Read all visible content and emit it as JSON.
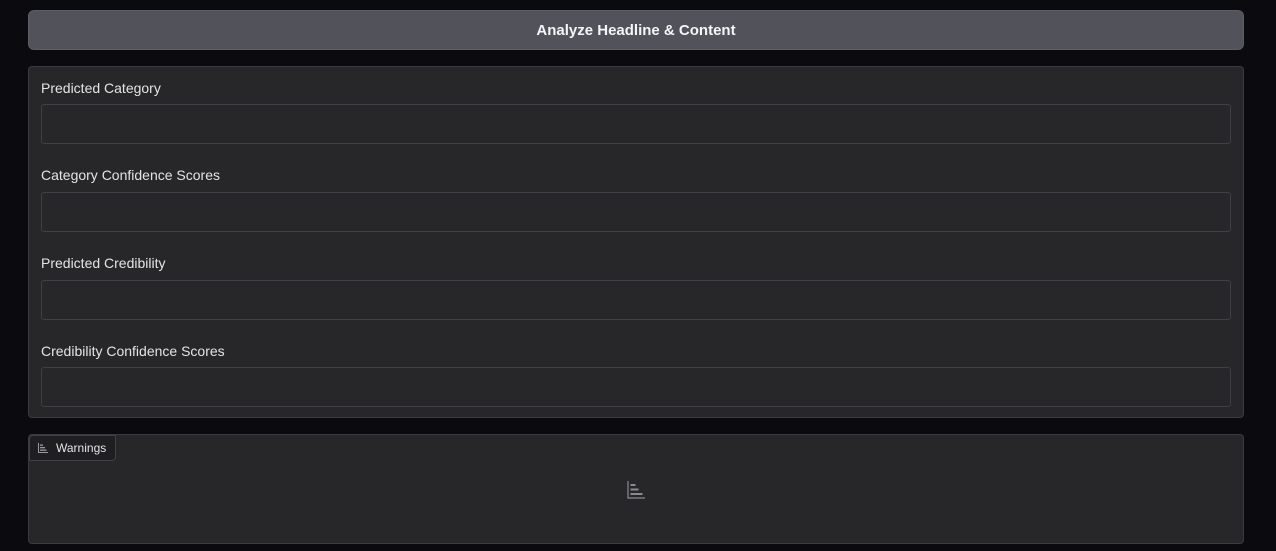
{
  "analyze_button": {
    "label": "Analyze Headline & Content"
  },
  "outputs": {
    "fields": [
      {
        "label": "Predicted Category",
        "value": ""
      },
      {
        "label": "Category Confidence Scores",
        "value": ""
      },
      {
        "label": "Predicted Credibility",
        "value": ""
      },
      {
        "label": "Credibility Confidence Scores",
        "value": ""
      }
    ]
  },
  "warnings": {
    "tab_label": "Warnings",
    "tab_icon": "bar-chart-icon",
    "placeholder_icon": "bar-chart-icon"
  }
}
